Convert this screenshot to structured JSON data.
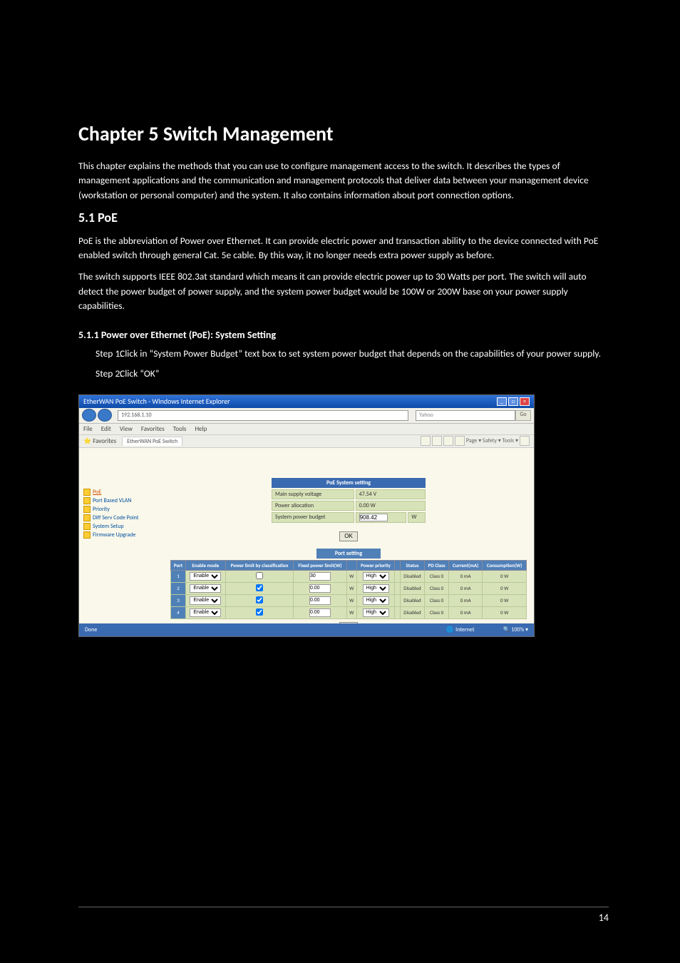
{
  "chapter_heading": "Chapter 5 Switch Management",
  "section_heading": "5.1 PoE",
  "chapter_intro": "This chapter explains the methods that you can use to configure management access to the switch. It describes the types of management applications and the communication and management protocols that deliver data between your management device (workstation or personal computer) and the system. It also contains information about port connection options.",
  "section_intro_1": "PoE is the abbreviation of Power over Ethernet. It can provide electric power and transaction ability to the device connected with PoE enabled switch through general Cat. 5e cable. By this way, it no longer needs extra power supply as before.",
  "section_intro_2": "The switch supports IEEE 802.3at standard which means it can provide electric power up to 30 Watts per port. The switch will auto detect the power budget of power supply, and the system power budget would be 100W or 200W base on your power supply capabilities.",
  "sub_heading": "5.1.1 Power over Ethernet (PoE): System Setting",
  "step1_part1": "C",
  "step1_part2": "lick in",
  "step1_quoted": "System Power Budget",
  "step1_part3": "text box",
  "step1_extra": " to set system power budget that depends on the capabilities of your power supply.",
  "step2_part1": "Click",
  "step2_quoted": "OK",
  "screenshot": {
    "window_title": "EtherWAN PoE Switch - Windows Internet Explorer",
    "url": "192.168.1.10",
    "search_placeholder": "Yahoo",
    "go_label": "Go",
    "menu": [
      "File",
      "Edit",
      "View",
      "Favorites",
      "Tools",
      "Help"
    ],
    "fav_label": "Favorites",
    "fav_tab": "EtherWAN PoE Switch",
    "fav_icons_text": "Page ▾  Safety ▾  Tools ▾",
    "sidebar": [
      {
        "label": "PoE",
        "active": true
      },
      {
        "label": "Port Based VLAN"
      },
      {
        "label": "Priority"
      },
      {
        "label": "Diff Serv Code Point"
      },
      {
        "label": "System Setup"
      },
      {
        "label": "Firmware Upgrade"
      }
    ],
    "sys_setting_title": "PoE System setting",
    "sys_rows": [
      {
        "k": "Main supply voltage",
        "v": "47.54 V"
      },
      {
        "k": "Power allocation",
        "v": "0.00 W"
      },
      {
        "k": "System power budget",
        "v": "908.42",
        "unit": "W",
        "editable": true
      }
    ],
    "ok_label": "OK",
    "port_title": "Port setting",
    "port_headers": [
      "Port",
      "Enable mode",
      "Power limit by classification",
      "Fixed power limit(W)",
      "",
      "Power priority",
      "",
      "Status",
      "PD Class",
      "Current(mA)",
      "Consumption(W)"
    ],
    "port_rows": [
      {
        "port": "1",
        "enable": "Enable",
        "cls": false,
        "limit": "30",
        "unit": "W",
        "prio": "High",
        "status": "Disabled",
        "class": "Class 0",
        "current": "0 mA",
        "cons": "0 W"
      },
      {
        "port": "2",
        "enable": "Enable",
        "cls": true,
        "limit": "0.00",
        "unit": "W",
        "prio": "High",
        "status": "Disabled",
        "class": "Class 0",
        "current": "0 mA",
        "cons": "0 W"
      },
      {
        "port": "3",
        "enable": "Enable",
        "cls": true,
        "limit": "0.00",
        "unit": "W",
        "prio": "High",
        "status": "Disabled",
        "class": "Class 0",
        "current": "0 mA",
        "cons": "0 W"
      },
      {
        "port": "4",
        "enable": "Enable",
        "cls": true,
        "limit": "0.00",
        "unit": "W",
        "prio": "High",
        "status": "Disabled",
        "class": "Class 0",
        "current": "0 mA",
        "cons": "0 W"
      }
    ],
    "status_done": "Done",
    "status_inet": "Internet",
    "status_zoom": "100%"
  },
  "page_number": "14"
}
